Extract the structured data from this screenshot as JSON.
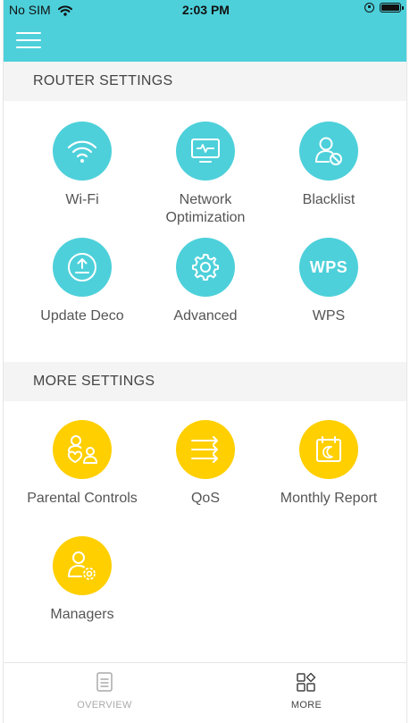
{
  "status_bar": {
    "carrier": "No SIM",
    "time": "2:03 PM"
  },
  "colors": {
    "header": "#4dd0da",
    "router_icon_bg": "#4dd0da",
    "more_icon_bg": "#ffcf00"
  },
  "router_settings": {
    "title": "ROUTER SETTINGS",
    "items": [
      {
        "label": "Wi-Fi",
        "icon": "wifi-icon"
      },
      {
        "label": "Network Optimization",
        "icon": "monitor-pulse-icon"
      },
      {
        "label": "Blacklist",
        "icon": "user-blocked-icon"
      },
      {
        "label": "Update Deco",
        "icon": "upload-icon"
      },
      {
        "label": "Advanced",
        "icon": "gear-icon"
      },
      {
        "label": "WPS",
        "icon": "wps-icon",
        "icon_text": "WPS"
      }
    ]
  },
  "more_settings": {
    "title": "MORE SETTINGS",
    "items": [
      {
        "label": "Parental Controls",
        "icon": "family-icon"
      },
      {
        "label": "QoS",
        "icon": "qos-arrows-icon"
      },
      {
        "label": "Monthly Report",
        "icon": "calendar-icon"
      },
      {
        "label": "Managers",
        "icon": "user-gear-icon"
      }
    ]
  },
  "tabbar": {
    "overview": "OVERVIEW",
    "more": "MORE"
  }
}
